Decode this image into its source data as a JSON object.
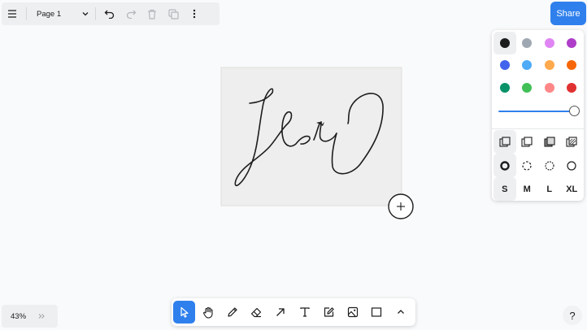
{
  "menu": {
    "page_name": "Page 1"
  },
  "share": {
    "label": "Share"
  },
  "colors": [
    "#1d1d1d",
    "#9fa8b2",
    "#e085f4",
    "#ae3ec9",
    "#4263eb",
    "#4dabf7",
    "#ffa94d",
    "#f76707",
    "#099268",
    "#40c057",
    "#ff8787",
    "#e03131"
  ],
  "selected_color": "#1d1d1d",
  "opacity": 1,
  "sizes": [
    "S",
    "M",
    "L",
    "XL"
  ],
  "selected_size": "S",
  "toolbar": {
    "tools": [
      "select-tool",
      "hand-tool",
      "draw-tool",
      "eraser-tool",
      "arrow-tool",
      "text-tool",
      "note-tool",
      "asset-tool",
      "rectangle-tool",
      "more-tools"
    ],
    "active_tool": "select-tool"
  },
  "zoom": {
    "level": "43%"
  },
  "help": {
    "label": "?"
  }
}
